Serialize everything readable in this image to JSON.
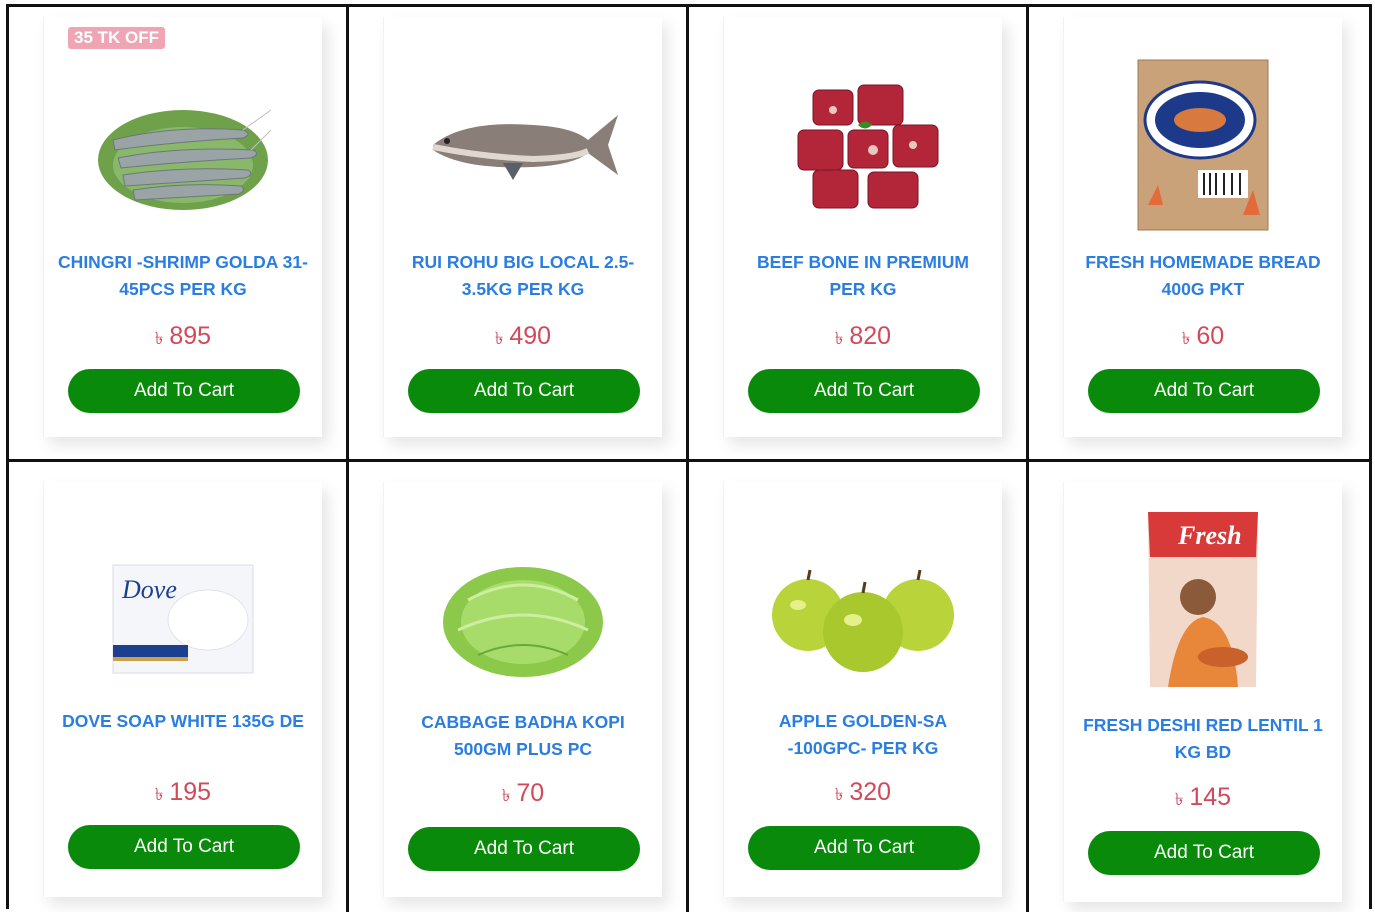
{
  "products": [
    {
      "name": "CHINGRI -SHRIMP GOLDA 31-45PCS PER KG",
      "currency": "৳",
      "price": "895",
      "badge": "35 TK OFF",
      "button": "Add To Cart",
      "image": "shrimp"
    },
    {
      "name": "RUI ROHU BIG LOCAL 2.5-3.5KG PER KG",
      "currency": "৳",
      "price": "490",
      "button": "Add To Cart",
      "image": "fish"
    },
    {
      "name": "BEEF BONE IN PREMIUM PER KG",
      "currency": "৳",
      "price": "820",
      "button": "Add To Cart",
      "image": "beef"
    },
    {
      "name": "FRESH HOMEMADE BREAD 400G PKT",
      "currency": "৳",
      "price": "60",
      "button": "Add To Cart",
      "image": "bread-packet"
    },
    {
      "name": "DOVE SOAP WHITE 135G DE",
      "currency": "৳",
      "price": "195",
      "button": "Add To Cart",
      "image": "dove-soap"
    },
    {
      "name": "CABBAGE BADHA KOPI 500GM PLUS PC",
      "currency": "৳",
      "price": "70",
      "button": "Add To Cart",
      "image": "cabbage"
    },
    {
      "name": "APPLE GOLDEN-SA -100GPC- PER KG",
      "currency": "৳",
      "price": "320",
      "button": "Add To Cart",
      "image": "apples"
    },
    {
      "name": "FRESH DESHI RED LENTIL 1 KG BD",
      "currency": "৳",
      "price": "145",
      "button": "Add To Cart",
      "image": "lentil-packet"
    }
  ],
  "image_labels": {
    "dove_brand": "Dove",
    "fresh_brand": "Fresh"
  },
  "colors": {
    "title": "#2a7de1",
    "price": "#d2495a",
    "button": "#0a8a0a",
    "badge": "#f0a5b5"
  }
}
